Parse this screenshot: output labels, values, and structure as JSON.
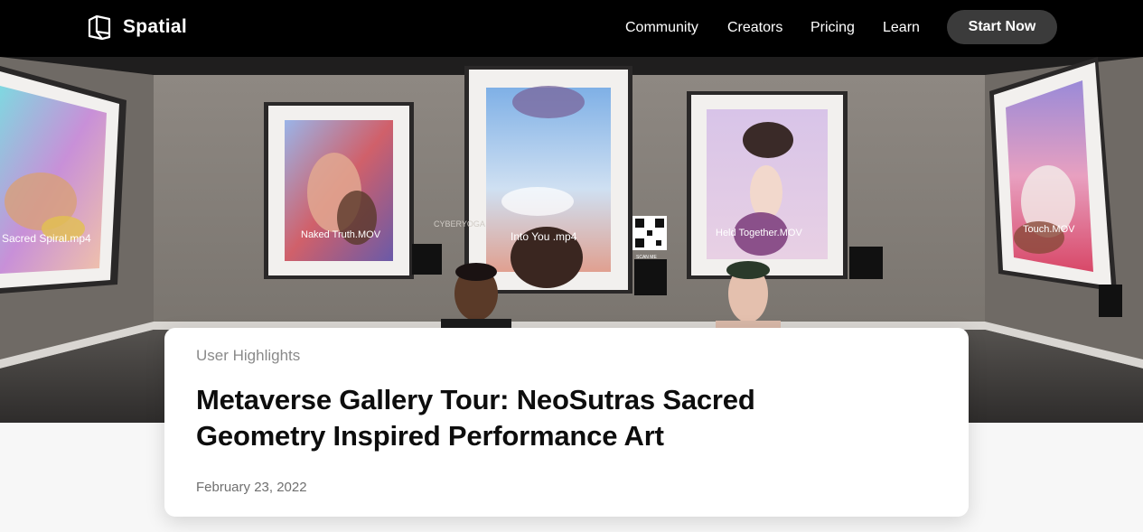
{
  "brand": {
    "name": "Spatial"
  },
  "nav": {
    "links": [
      "Community",
      "Creators",
      "Pricing",
      "Learn"
    ],
    "cta": "Start Now"
  },
  "hero": {
    "artworks": [
      {
        "caption": "Sacred Spiral.mp4"
      },
      {
        "caption": "Naked Truth.MOV"
      },
      {
        "caption": "Into You .mp4"
      },
      {
        "caption": "Held Together.MOV"
      },
      {
        "caption": "Touch.MOV"
      }
    ],
    "wall_text": "CYBERYOGA",
    "qr_label": "SCAN ME"
  },
  "article": {
    "category": "User Highlights",
    "title": "Metaverse Gallery Tour: NeoSutras Sacred Geometry Inspired Performance Art",
    "date": "February 23, 2022"
  }
}
